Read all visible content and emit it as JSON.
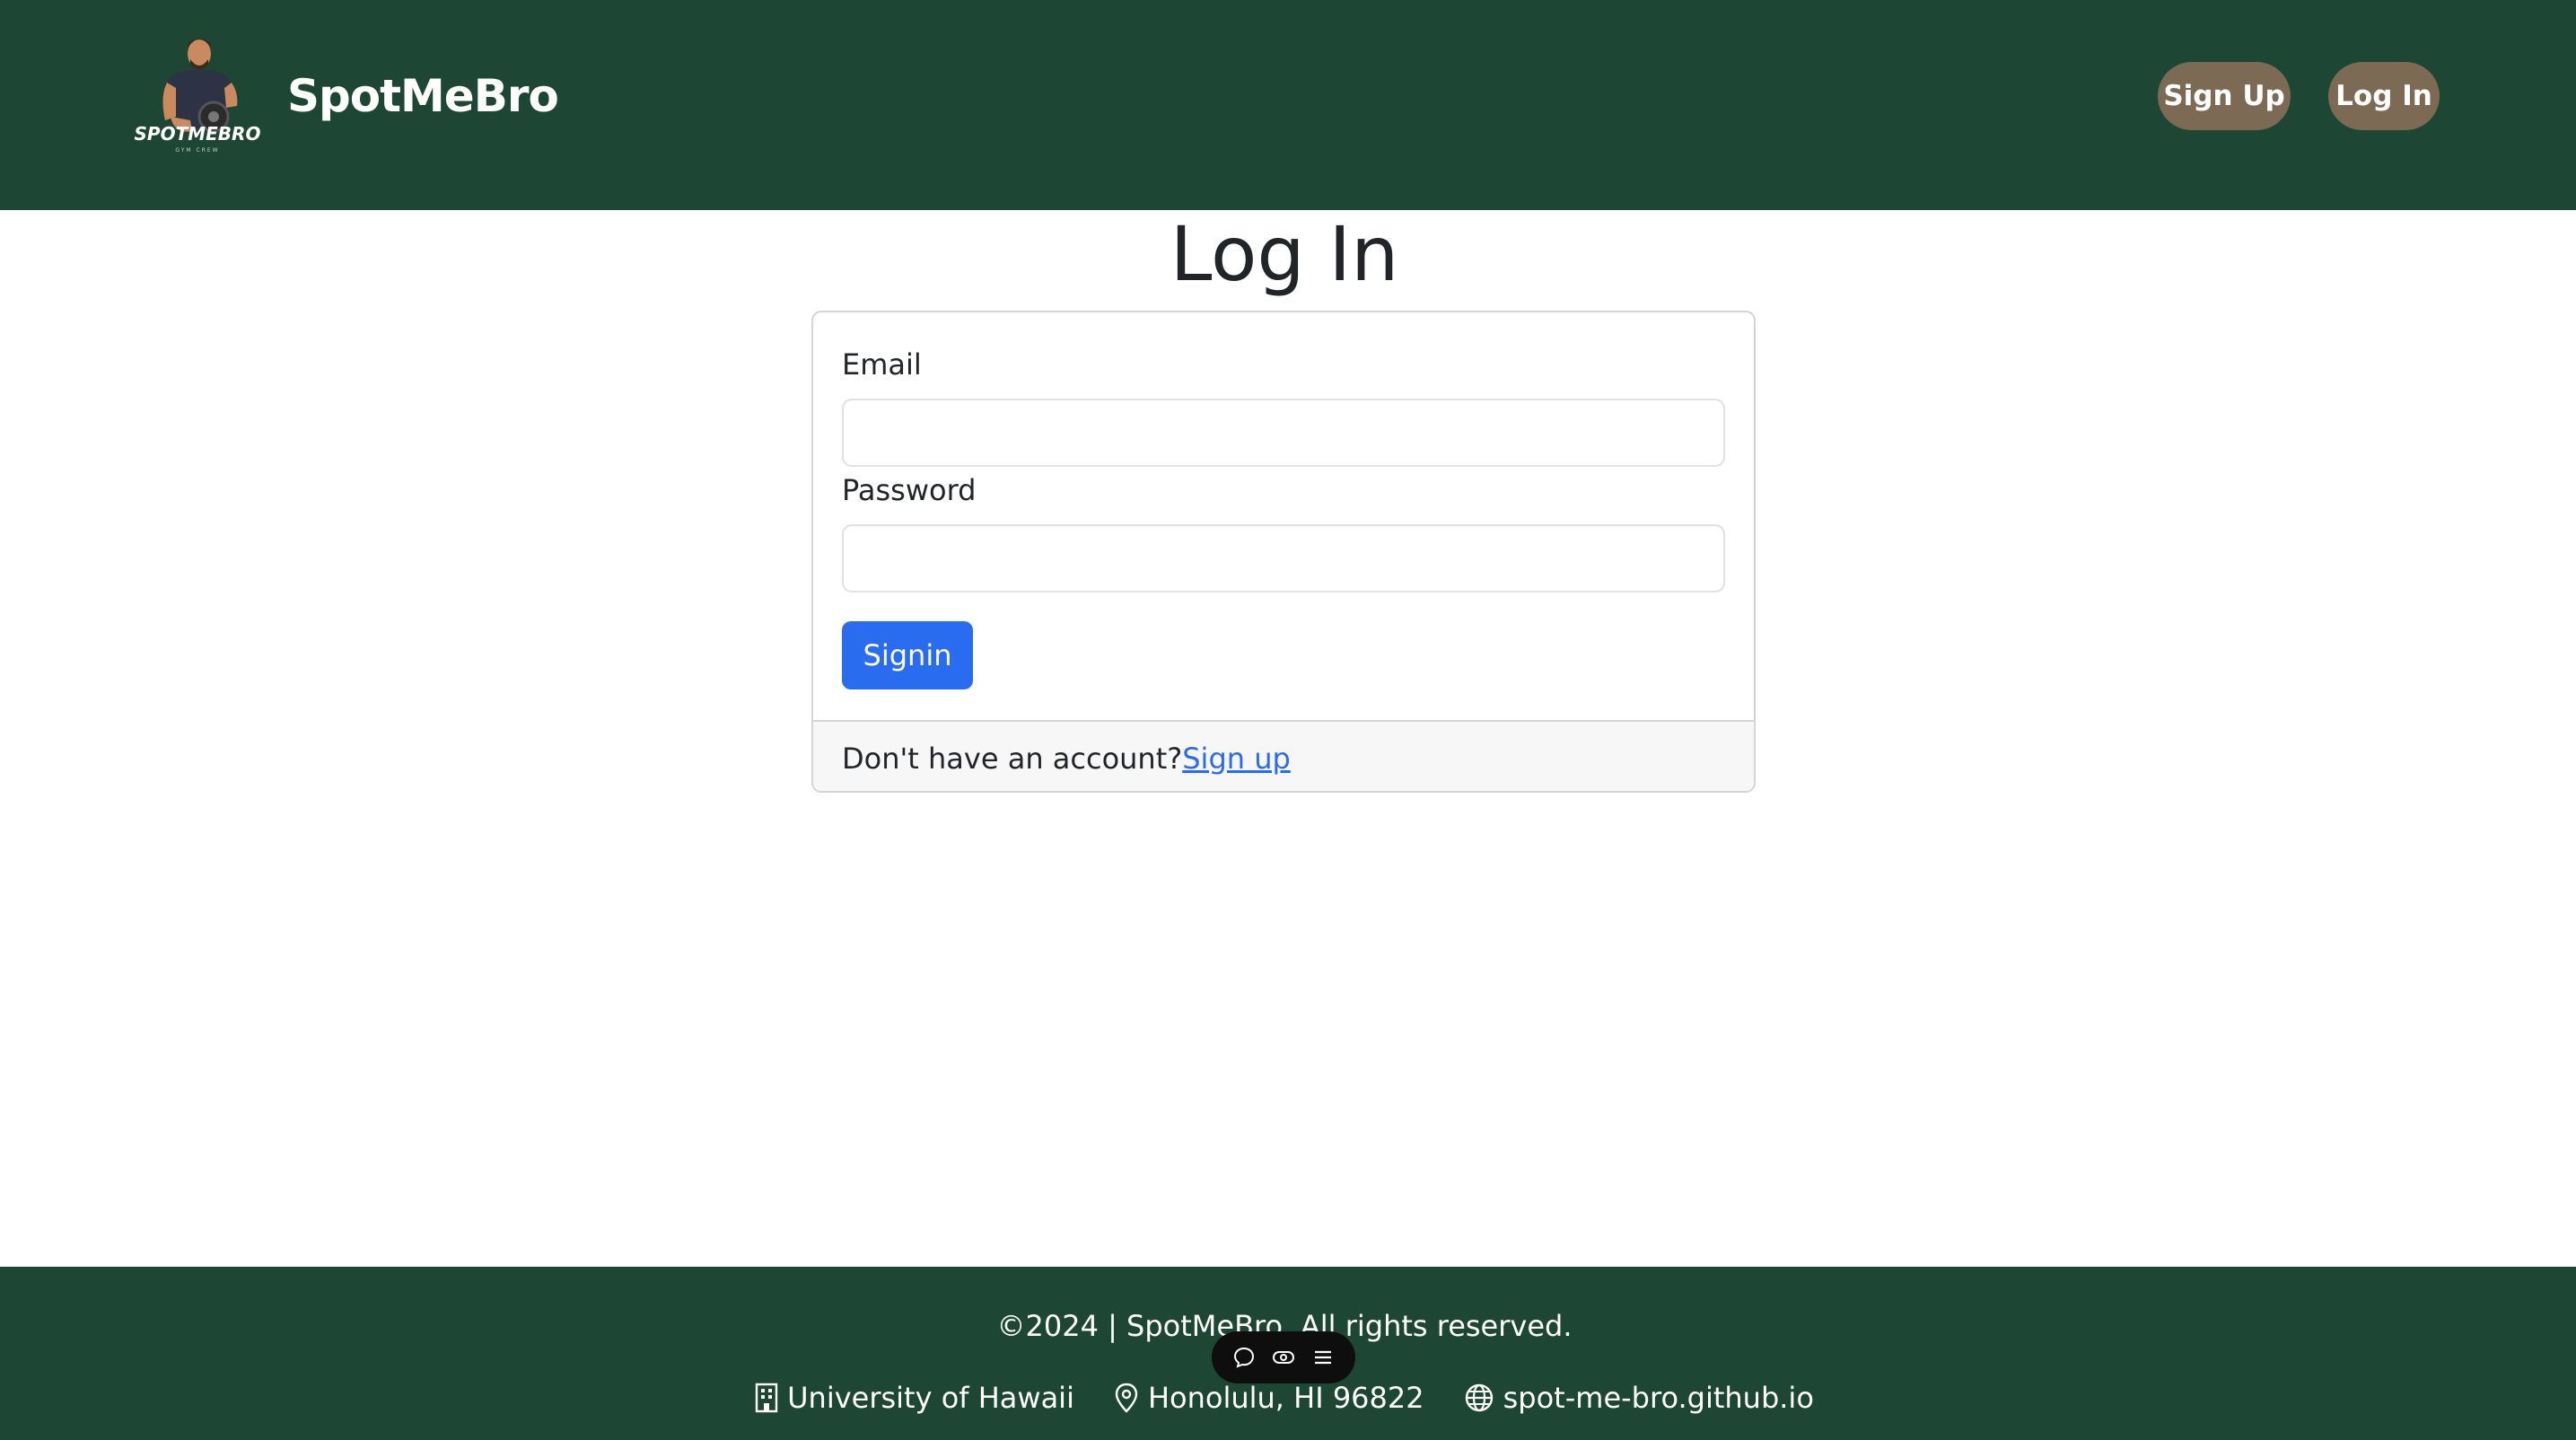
{
  "navbar": {
    "brand_name": "SpotMeBro",
    "logo_text": "SPOTMEBRO",
    "logo_subtext": "GYM CREW",
    "signup_label": "Sign Up",
    "login_label": "Log In"
  },
  "main": {
    "title": "Log In",
    "email_label": "Email",
    "email_value": "",
    "password_label": "Password",
    "password_value": "",
    "signin_label": "Signin",
    "footer_prompt": "Don't have an account?",
    "footer_link": "Sign up"
  },
  "footer": {
    "copyright": "©2024 | SpotMeBro. All rights reserved.",
    "university": "University of Hawaii",
    "location": "Honolulu, HI 96822",
    "website": "spot-me-bro.github.io"
  },
  "toolbar": {
    "icons": [
      "chat-icon",
      "eye-icon",
      "menu-icon"
    ]
  },
  "colors": {
    "brand_green": "#1e4634",
    "nav_button": "#7d6a54",
    "primary_blue": "#2a6cef"
  }
}
